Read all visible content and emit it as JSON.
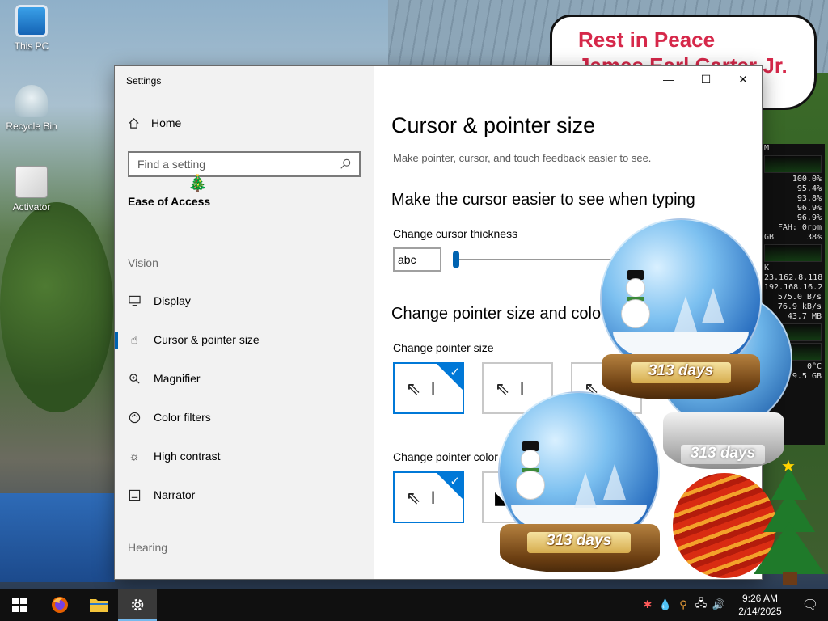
{
  "desktop": {
    "icons": [
      {
        "label": "This PC"
      },
      {
        "label": "Recycle Bin"
      },
      {
        "label": "Activator"
      }
    ],
    "banner_lines": [
      "Rest in Peace",
      "James Earl Carter Jr."
    ],
    "gadget": {
      "cpu_header": "M",
      "cpu_values": [
        "100.0%",
        "95.4%",
        "93.8%",
        "96.9%",
        "96.9%"
      ],
      "fan": "FAH: 0rpm",
      "mem_unit": "GB",
      "mem_percent": "38%",
      "net_header": "K",
      "ip_public": "23.162.8.118",
      "ip_local": "192.168.16.2",
      "upload": "575.0 B/s",
      "download": "76.9 kB/s",
      "total": "43.7 MB",
      "temp": "0°C",
      "disk": "9.5 GB"
    },
    "globe_caption": "313 days"
  },
  "settings": {
    "window_title": "Settings",
    "controls": {
      "minimize": "—",
      "maximize": "☐",
      "close": "✕"
    },
    "nav": {
      "home": "Home",
      "search_placeholder": "Find a setting",
      "group": "Ease of Access",
      "vision_label": "Vision",
      "items": [
        {
          "label": "Display",
          "icon": "display-icon"
        },
        {
          "label": "Cursor & pointer size",
          "icon": "pointer-icon"
        },
        {
          "label": "Magnifier",
          "icon": "magnifier-icon"
        },
        {
          "label": "Color filters",
          "icon": "palette-icon"
        },
        {
          "label": "High contrast",
          "icon": "sun-icon"
        },
        {
          "label": "Narrator",
          "icon": "narrator-icon"
        }
      ],
      "hearing_label": "Hearing"
    },
    "content": {
      "title": "Cursor & pointer size",
      "subtitle": "Make pointer, cursor, and touch feedback easier to see.",
      "section1": "Make the cursor easier to see when typing",
      "thickness_label": "Change cursor thickness",
      "preview_text": "abc",
      "thickness_value": 1,
      "section2": "Change pointer size and colo",
      "size_label": "Change pointer size",
      "color_label": "Change pointer color"
    }
  },
  "taskbar": {
    "time": "9:26 AM",
    "date": "2/14/2025"
  },
  "colors": {
    "accent": "#0078d7",
    "banner_text": "#d6284a"
  }
}
